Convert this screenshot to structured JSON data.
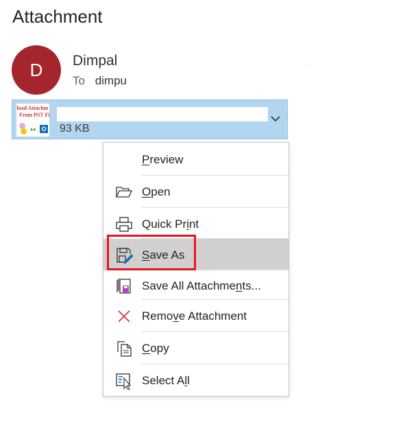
{
  "header": {
    "title": "Attachment"
  },
  "message": {
    "avatar_initial": "D",
    "sender": "Dimpal",
    "to_label": "To",
    "to_name": "dimpu"
  },
  "attachment": {
    "thumb_line1": "nload Attachm",
    "thumb_line2": "From PST File",
    "size": "93 KB",
    "outlook_letter": "O",
    "arrow": "↔"
  },
  "menu": {
    "items": [
      {
        "pre": "",
        "key": "P",
        "post": "review",
        "icon": "none"
      },
      {
        "pre": "",
        "key": "O",
        "post": "pen",
        "icon": "folder-open-icon"
      },
      {
        "pre": "Quick Pr",
        "key": "i",
        "post": "nt",
        "icon": "printer-icon"
      },
      {
        "pre": "",
        "key": "S",
        "post": "ave As",
        "icon": "save-as-icon"
      },
      {
        "pre": "Save All Attachme",
        "key": "n",
        "post": "ts...",
        "icon": "save-all-icon"
      },
      {
        "pre": "Remo",
        "key": "v",
        "post": "e Attachment",
        "icon": "close-x-icon"
      },
      {
        "pre": "",
        "key": "C",
        "post": "opy",
        "icon": "copy-icon"
      },
      {
        "pre": "Select A",
        "key": "l",
        "post": "l",
        "icon": "select-all-icon"
      }
    ]
  },
  "colors": {
    "avatar": "#a4262c",
    "attachment_bg": "#b3d6f0",
    "hover_row": "#d2d0ce",
    "highlight_border": "#e81123"
  }
}
